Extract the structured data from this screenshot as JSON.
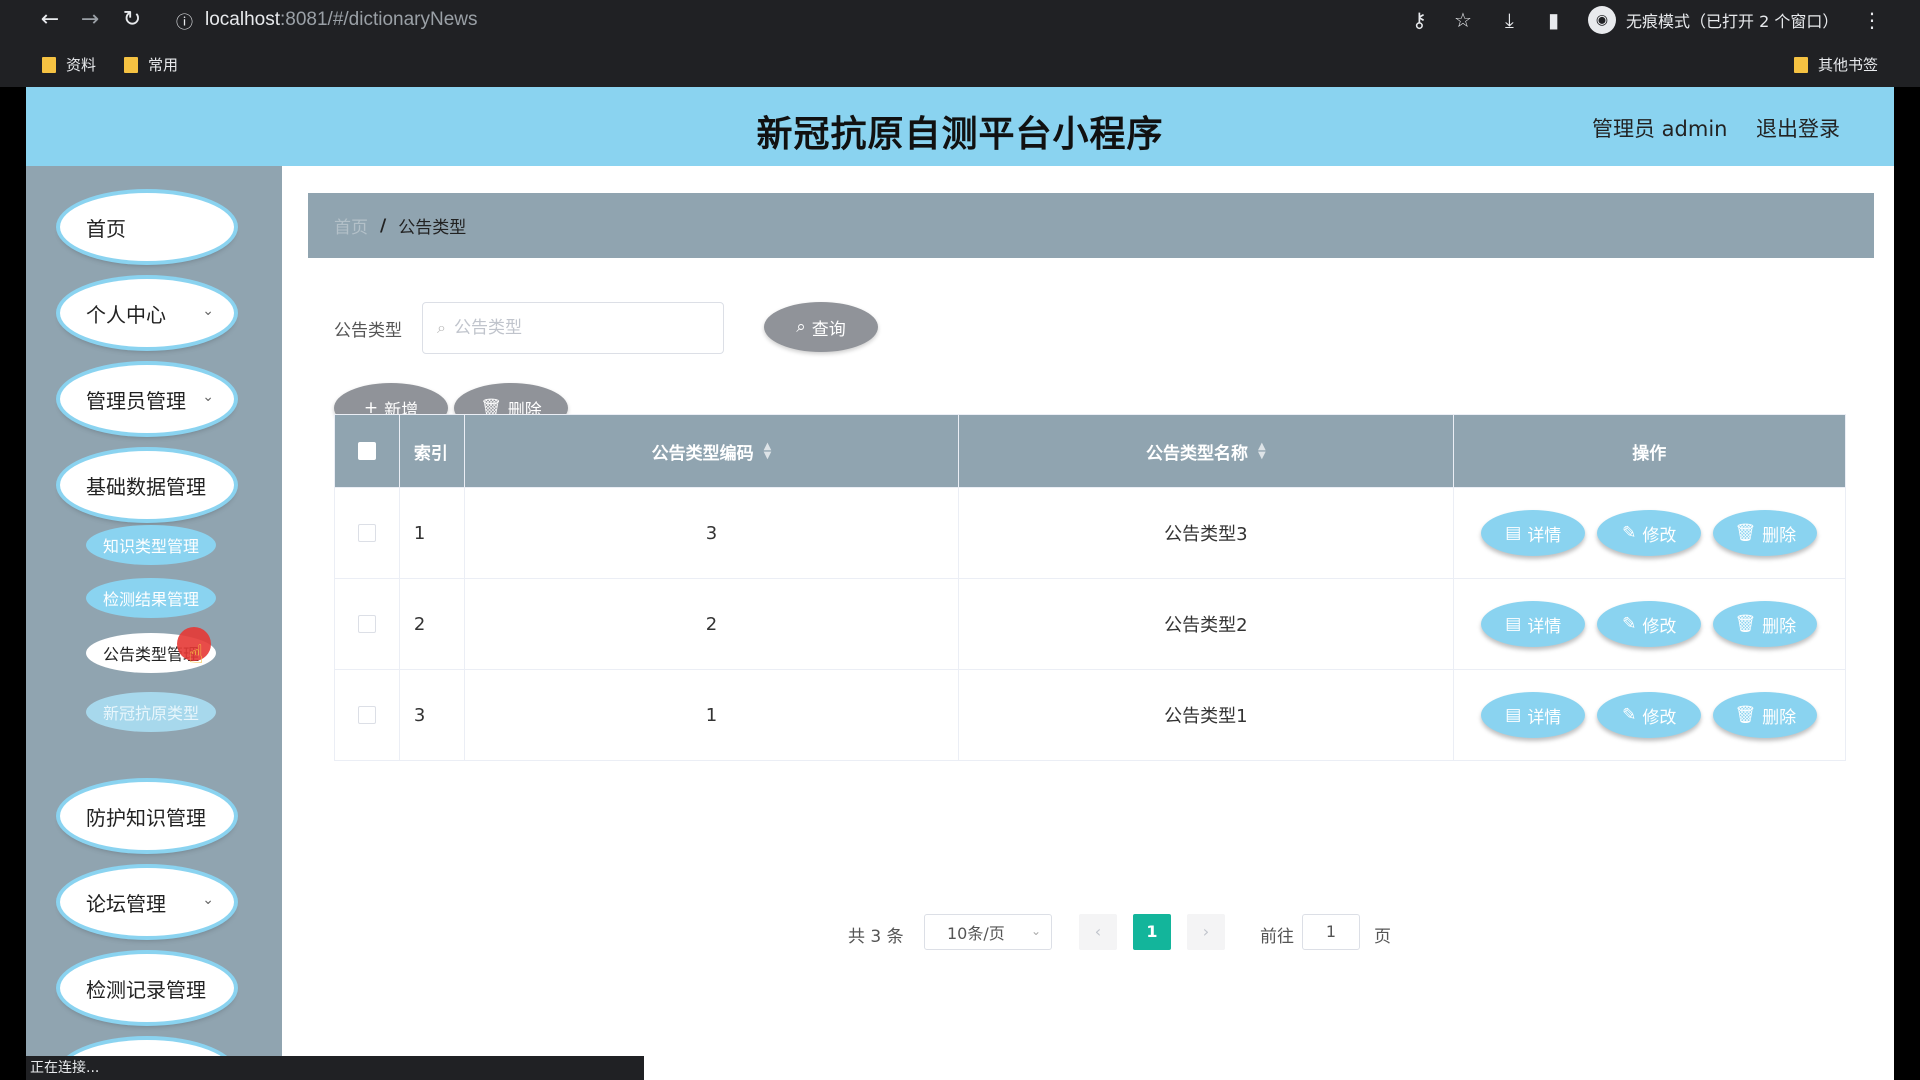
{
  "browser": {
    "url_host": "localhost",
    "url_rest": ":8081/#/dictionaryNews",
    "incognito_label": "无痕模式（已打开 2 个窗口）",
    "bookmarks": [
      {
        "label": "资料"
      },
      {
        "label": "常用"
      }
    ],
    "other_bookmarks": "其他书签",
    "status": "正在连接..."
  },
  "header": {
    "title": "新冠抗原自测平台小程序",
    "user": "管理员 admin",
    "logout": "退出登录",
    "bg_color": "#8ad3f0"
  },
  "sidebar": {
    "items": [
      {
        "label": "首页"
      },
      {
        "label": "个人中心"
      },
      {
        "label": "管理员管理"
      },
      {
        "label": "基础数据管理"
      },
      {
        "label": "防护知识管理"
      },
      {
        "label": "论坛管理"
      },
      {
        "label": "检测记录管理"
      }
    ],
    "subitems": [
      {
        "label": "知识类型管理"
      },
      {
        "label": "检测结果管理"
      },
      {
        "label": "公告类型管理"
      },
      {
        "label": "新冠抗原类型"
      }
    ]
  },
  "breadcrumb": {
    "home": "首页",
    "sep": "/",
    "current": "公告类型"
  },
  "filter": {
    "label": "公告类型",
    "placeholder": "公告类型",
    "search_btn": "查询"
  },
  "actions": {
    "add": "新增",
    "delete": "删除"
  },
  "table": {
    "headers": {
      "index": "索引",
      "code": "公告类型编码",
      "name": "公告类型名称",
      "ops": "操作"
    },
    "rows": [
      {
        "index": "1",
        "code": "3",
        "name": "公告类型3"
      },
      {
        "index": "2",
        "code": "2",
        "name": "公告类型2"
      },
      {
        "index": "3",
        "code": "1",
        "name": "公告类型1"
      }
    ],
    "op_labels": {
      "detail": "详情",
      "edit": "修改",
      "delete": "删除"
    }
  },
  "pager": {
    "total": "共 3 条",
    "page_size": "10条/页",
    "current": "1",
    "goto": "前往",
    "goto_value": "1",
    "page": "页"
  },
  "colors": {
    "accent_blue": "#8ad3f0",
    "sidebar_gray": "#90a4b0",
    "pager_active": "#13b59b"
  }
}
